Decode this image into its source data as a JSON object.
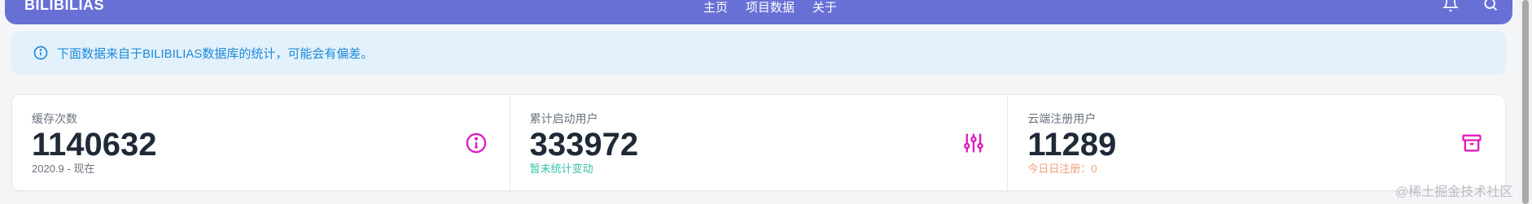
{
  "navbar": {
    "brand": "BILIBILIAS",
    "menu": [
      "主页",
      "项目数据",
      "关于"
    ],
    "icons": [
      "bell-icon",
      "search-icon"
    ],
    "color": "#6870d6"
  },
  "alert": {
    "icon": "info-circle-icon",
    "text": "下面数据来自于BILIBILIAS数据库的统计，可能会有偏差。",
    "color": "#1d8ad8",
    "background": "#e3f1fc"
  },
  "stats": [
    {
      "title": "缓存次数",
      "value": "1140632",
      "desc": "2020.9 - 现在",
      "icon": "info-circle-icon"
    },
    {
      "title": "累计启动用户",
      "value": "333972",
      "desc": "暂未统计变动",
      "icon": "sliders-icon"
    },
    {
      "title": "云端注册用户",
      "value": "11289",
      "desc": "今日日注册：0",
      "icon": "archive-box-icon"
    }
  ],
  "accent": "#e01ac0",
  "watermark": "@稀土掘金技术社区"
}
